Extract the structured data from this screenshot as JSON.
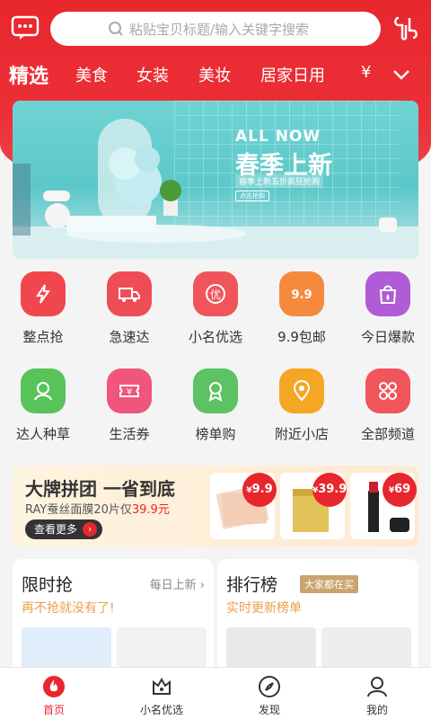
{
  "search": {
    "placeholder": "粘贴宝贝标题/输入关键字搜索"
  },
  "categories": [
    "精选",
    "美食",
    "女装",
    "美妆",
    "居家日用",
    "¥"
  ],
  "banner": {
    "line1": "ALL NOW",
    "line2": "春季上新",
    "line3": "春季上新五折疯狂抢购",
    "button": "点击抢购"
  },
  "grid": [
    {
      "label": "整点抢",
      "color": "#f0474e",
      "icon": "lightning-icon"
    },
    {
      "label": "急速达",
      "color": "#ef4d55",
      "icon": "truck-icon"
    },
    {
      "label": "小名优选",
      "color": "#f0555c",
      "icon": "you-icon"
    },
    {
      "label": "9.9包邮",
      "color": "#f68a3c",
      "icon": "nine-nine-icon"
    },
    {
      "label": "今日爆款",
      "color": "#b05cd6",
      "icon": "bag-icon"
    },
    {
      "label": "达人种草",
      "color": "#58c35b",
      "icon": "person-icon"
    },
    {
      "label": "生活券",
      "color": "#f0557c",
      "icon": "coupon-icon"
    },
    {
      "label": "榜单购",
      "color": "#5cc263",
      "icon": "medal-icon"
    },
    {
      "label": "附近小店",
      "color": "#f5a623",
      "icon": "location-icon"
    },
    {
      "label": "全部频道",
      "color": "#f0555c",
      "icon": "grid-icon"
    }
  ],
  "promo": {
    "title": "大牌拼团 一省到底",
    "sub_prefix": "RAY蚕丝面膜20片仅",
    "sub_price": "39.9元",
    "button": "查看更多",
    "badges": [
      "9.9",
      "39.9",
      "69"
    ],
    "currency": "¥"
  },
  "flash": {
    "title": "限时抢",
    "more": "每日上新",
    "sub": "再不抢就没有了!"
  },
  "rank": {
    "title": "排行榜",
    "tag": "大家都在买",
    "sub": "实时更新榜单"
  },
  "tabs": [
    {
      "label": "首页",
      "icon": "home-flame-icon"
    },
    {
      "label": "小名优选",
      "icon": "crown-icon"
    },
    {
      "label": "发现",
      "icon": "compass-icon"
    },
    {
      "label": "我的",
      "icon": "user-icon"
    }
  ],
  "colors": {
    "brand": "#e8262d",
    "accent_gold": "#c9a46c"
  }
}
